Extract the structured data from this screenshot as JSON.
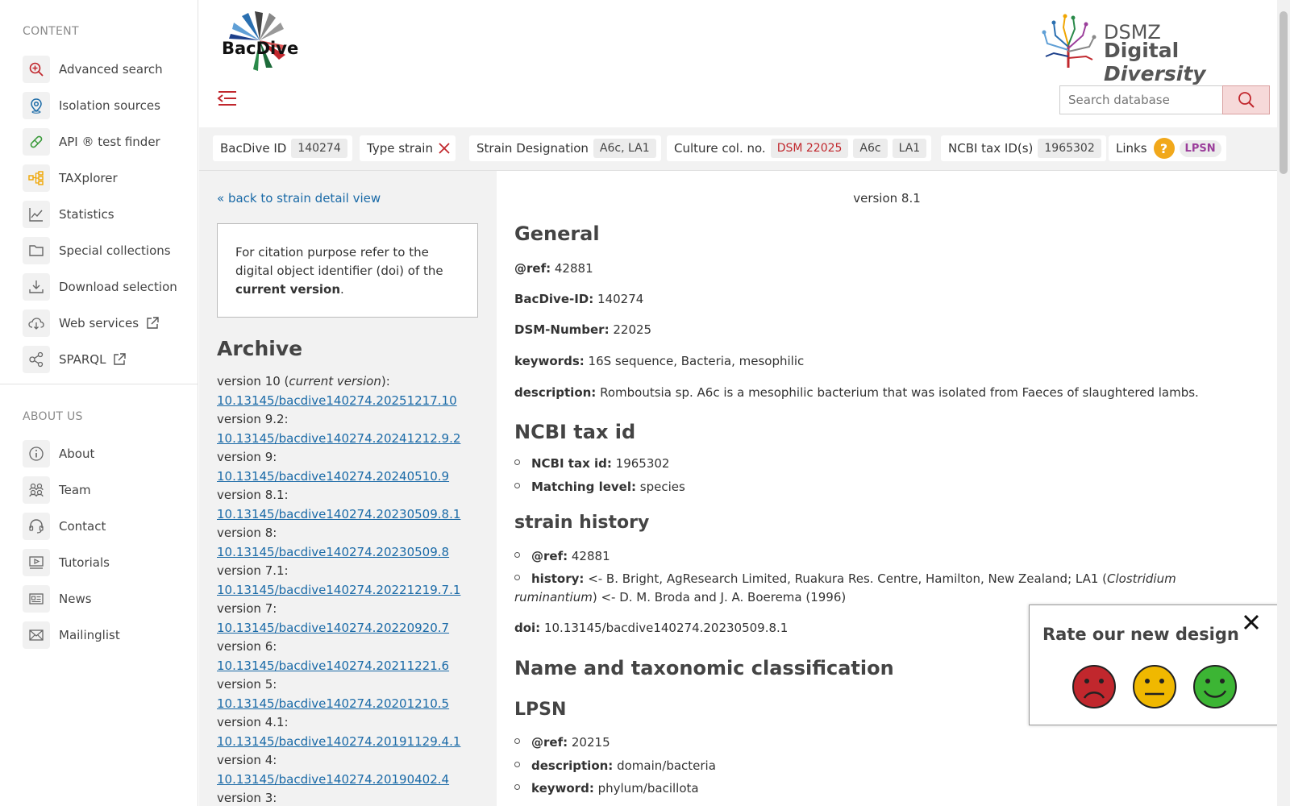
{
  "sidebar": {
    "content_heading": "CONTENT",
    "content_items": [
      {
        "label": "Advanced search",
        "icon": "search-plus-icon"
      },
      {
        "label": "Isolation sources",
        "icon": "location-pin-icon"
      },
      {
        "label": "API ® test finder",
        "icon": "pill-icon"
      },
      {
        "label": "TAXplorer",
        "icon": "tree-diagram-icon"
      },
      {
        "label": "Statistics",
        "icon": "line-chart-icon"
      },
      {
        "label": "Special collections",
        "icon": "folder-icon"
      },
      {
        "label": "Download selection",
        "icon": "download-icon"
      },
      {
        "label": "Web services",
        "icon": "cloud-download-icon"
      },
      {
        "label": "SPARQL",
        "icon": "share-nodes-icon"
      }
    ],
    "about_heading": "ABOUT US",
    "about_items": [
      {
        "label": "About",
        "icon": "info-icon"
      },
      {
        "label": "Team",
        "icon": "team-icon"
      },
      {
        "label": "Contact",
        "icon": "headset-icon"
      },
      {
        "label": "Tutorials",
        "icon": "video-icon"
      },
      {
        "label": "News",
        "icon": "newspaper-icon"
      },
      {
        "label": "Mailinglist",
        "icon": "mail-icon"
      }
    ]
  },
  "header": {
    "logo_text": "BacDive",
    "dsmz_line1": "DSMZ",
    "dsmz_line2a": "Digital",
    "dsmz_line2b": "Diversity",
    "search_placeholder": "Search database"
  },
  "infobar": {
    "bacdive_id_label": "BacDive ID",
    "bacdive_id_value": "140274",
    "type_strain_label": "Type strain",
    "designation_label": "Strain Designation",
    "designation_value": "A6c, LA1",
    "culture_label": "Culture col. no.",
    "culture_values": [
      "DSM 22025",
      "A6c",
      "LA1"
    ],
    "ncbi_label": "NCBI tax ID(s)",
    "ncbi_value": "1965302",
    "links_label": "Links",
    "links_badge": "LPSN"
  },
  "left": {
    "back_link": "« back to strain detail view",
    "cite_text_1": "For citation purpose refer to the digital object identifier (doi) of the",
    "cite_bold": "current version",
    "cite_end": ".",
    "archive_title": "Archive",
    "archive": [
      {
        "label": "version 10 (",
        "label_italic": "current version",
        "label_end": "):",
        "doi": "10.13145/bacdive140274.20251217.10"
      },
      {
        "label": "version 9.2:",
        "label_italic": "",
        "label_end": "",
        "doi": "10.13145/bacdive140274.20241212.9.2"
      },
      {
        "label": "version 9:",
        "label_italic": "",
        "label_end": "",
        "doi": "10.13145/bacdive140274.20240510.9"
      },
      {
        "label": "version 8.1:",
        "label_italic": "",
        "label_end": "",
        "doi": "10.13145/bacdive140274.20230509.8.1"
      },
      {
        "label": "version 8:",
        "label_italic": "",
        "label_end": "",
        "doi": "10.13145/bacdive140274.20230509.8"
      },
      {
        "label": "version 7.1:",
        "label_italic": "",
        "label_end": "",
        "doi": "10.13145/bacdive140274.20221219.7.1"
      },
      {
        "label": "version 7:",
        "label_italic": "",
        "label_end": "",
        "doi": "10.13145/bacdive140274.20220920.7"
      },
      {
        "label": "version 6:",
        "label_italic": "",
        "label_end": "",
        "doi": "10.13145/bacdive140274.20211221.6"
      },
      {
        "label": "version 5:",
        "label_italic": "",
        "label_end": "",
        "doi": "10.13145/bacdive140274.20201210.5"
      },
      {
        "label": "version 4.1:",
        "label_italic": "",
        "label_end": "",
        "doi": "10.13145/bacdive140274.20191129.4.1"
      },
      {
        "label": "version 4:",
        "label_italic": "",
        "label_end": "",
        "doi": "10.13145/bacdive140274.20190402.4"
      },
      {
        "label": "version 3:",
        "label_italic": "",
        "label_end": "",
        "doi": ""
      }
    ]
  },
  "main": {
    "version": "version 8.1",
    "general_title": "General",
    "ref_label": "@ref:",
    "ref_value": "42881",
    "bacdive_label": "BacDive-ID:",
    "bacdive_value": "140274",
    "dsm_label": "DSM-Number:",
    "dsm_value": "22025",
    "keywords_label": "keywords:",
    "keywords_value": "16S sequence, Bacteria, mesophilic",
    "desc_label": "description:",
    "desc_value": "Romboutsia sp. A6c is a mesophilic bacterium that was isolated from Faeces of slaughtered lambs.",
    "ncbi_title": "NCBI tax id",
    "ncbi_label": "NCBI tax id:",
    "ncbi_value": "1965302",
    "matching_label": "Matching level:",
    "matching_value": "species",
    "history_title": "strain history",
    "hist_ref_label": "@ref:",
    "hist_ref_value": "42881",
    "history_label": "history:",
    "history_value_1": "<- B. Bright, AgResearch Limited, Ruakura Res. Centre, Hamilton, New Zealand; LA1 (",
    "history_italic": "Clostridium ruminantium",
    "history_value_2": ") <- D. M. Broda and J. A. Boerema (1996)",
    "doi_label": "doi:",
    "doi_value": "10.13145/bacdive140274.20230509.8.1",
    "taxo_title": "Name and taxonomic classification",
    "lpsn_title": "LPSN",
    "lpsn_ref_label": "@ref:",
    "lpsn_ref_value": "20215",
    "lpsn_desc_label": "description:",
    "lpsn_desc_value": "domain/bacteria",
    "lpsn_kw_label": "keyword:",
    "lpsn_kw_value": "phylum/bacillota"
  },
  "popup": {
    "title": "Rate our new design",
    "faces": [
      "sad-face-icon",
      "neutral-face-icon",
      "happy-face-icon"
    ]
  },
  "colors": {
    "accent": "#c1272d",
    "link": "#1a6aa7",
    "lpsn": "#9b3e9b"
  }
}
